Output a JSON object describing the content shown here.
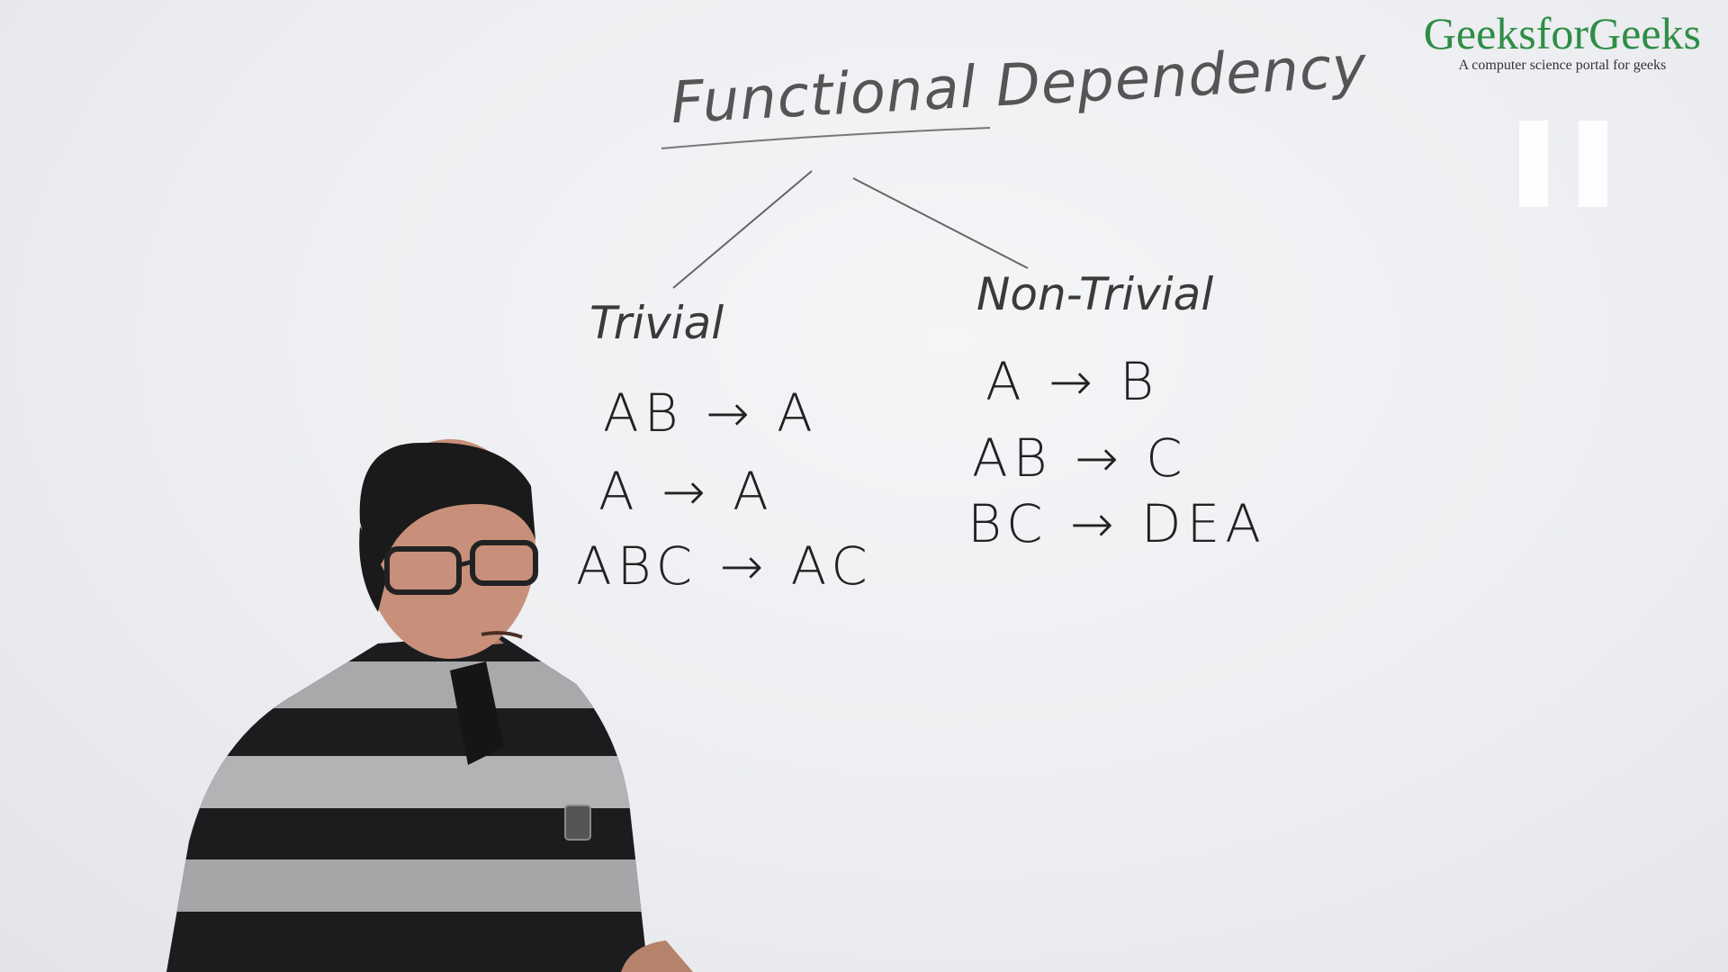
{
  "whiteboard": {
    "title": "Functional Dependency",
    "trivial": {
      "label": "Trivial",
      "items": [
        "AB → A",
        "A → A",
        "ABC → AC"
      ]
    },
    "non_trivial": {
      "label": "Non-Trivial",
      "items": [
        "A → B",
        "AB → C",
        "BC → DEA"
      ]
    }
  },
  "logo": {
    "name": "GeeksforGeeks",
    "tagline": "A computer science portal for geeks"
  },
  "overlay": {
    "icon": "pause-icon"
  },
  "colors": {
    "brand": "#2f8d46",
    "ink": "#2b2b2b",
    "board": "#eef0f3"
  }
}
